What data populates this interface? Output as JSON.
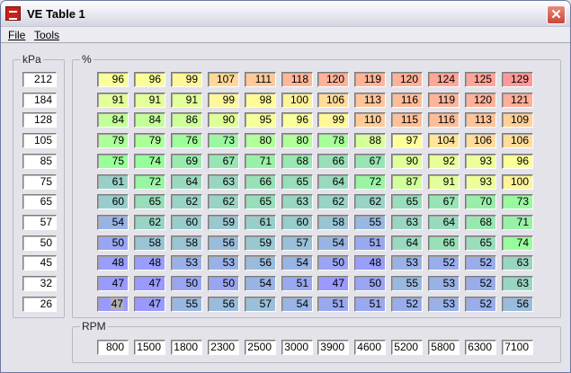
{
  "window": {
    "title": "VE Table 1",
    "close_label": "✕"
  },
  "menu": [
    {
      "label": "File"
    },
    {
      "label": "Tools"
    }
  ],
  "kpa": {
    "label": "kPa",
    "values": [
      "212",
      "184",
      "128",
      "105",
      "85",
      "75",
      "65",
      "57",
      "50",
      "45",
      "32",
      "26"
    ]
  },
  "table": {
    "label": "%",
    "selected": {
      "row": 11,
      "col": 0
    },
    "rows": [
      [
        96,
        96,
        99,
        107,
        111,
        118,
        120,
        119,
        120,
        124,
        125,
        129
      ],
      [
        91,
        91,
        91,
        99,
        98,
        100,
        106,
        113,
        116,
        119,
        120,
        121
      ],
      [
        84,
        84,
        86,
        90,
        95,
        96,
        99,
        110,
        115,
        116,
        113,
        109
      ],
      [
        79,
        79,
        76,
        73,
        80,
        80,
        78,
        88,
        97,
        104,
        106,
        106
      ],
      [
        75,
        74,
        69,
        67,
        71,
        68,
        66,
        67,
        90,
        92,
        93,
        96
      ],
      [
        61,
        72,
        64,
        63,
        66,
        65,
        64,
        72,
        87,
        91,
        93,
        100
      ],
      [
        60,
        65,
        62,
        62,
        65,
        63,
        62,
        62,
        65,
        67,
        70,
        73
      ],
      [
        54,
        62,
        60,
        59,
        61,
        60,
        58,
        55,
        63,
        64,
        68,
        71
      ],
      [
        50,
        58,
        58,
        56,
        59,
        57,
        54,
        51,
        64,
        66,
        65,
        74
      ],
      [
        48,
        48,
        53,
        53,
        56,
        54,
        50,
        48,
        53,
        52,
        52,
        63
      ],
      [
        47,
        47,
        50,
        50,
        54,
        51,
        47,
        50,
        55,
        53,
        52,
        63
      ],
      [
        47,
        47,
        55,
        56,
        57,
        54,
        51,
        51,
        52,
        53,
        52,
        56
      ]
    ]
  },
  "rpm": {
    "label": "RPM",
    "values": [
      "800",
      "1500",
      "1800",
      "2300",
      "2500",
      "3000",
      "3900",
      "4600",
      "5200",
      "5800",
      "6300",
      "7100"
    ]
  },
  "color_scale": [
    {
      "v": 47,
      "c": "#9999ff"
    },
    {
      "v": 60,
      "c": "#99cccc"
    },
    {
      "v": 75,
      "c": "#99ff99"
    },
    {
      "v": 97,
      "c": "#ffff99"
    },
    {
      "v": 110,
      "c": "#ffcc99"
    },
    {
      "v": 129,
      "c": "#ff9999"
    }
  ]
}
